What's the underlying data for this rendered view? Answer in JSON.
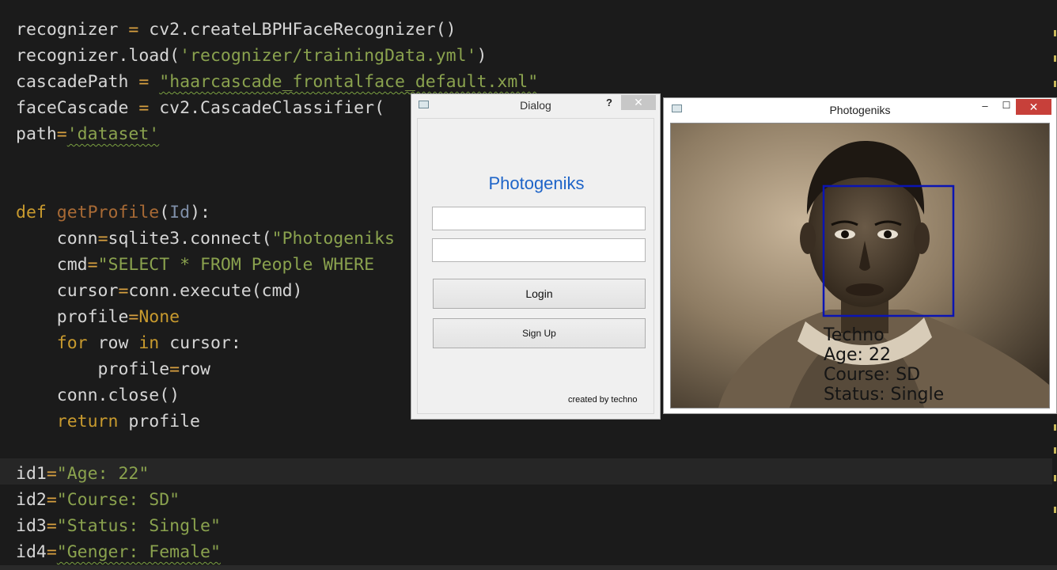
{
  "editor": {
    "lines": {
      "l1_a": "recognizer ",
      "l1_b": "=",
      "l1_c": " cv2.createLBPHFaceRecognizer()",
      "l2_a": "recognizer.load(",
      "l2_b": "'recognizer/trainingData.yml'",
      "l2_c": ")",
      "l3_a": "cascadePath ",
      "l3_b": "=",
      "l3_c": " ",
      "l3_d": "\"haarcascade_frontalface_default.xml\"",
      "l4_a": "faceCascade ",
      "l4_b": "=",
      "l4_c": " cv2.CascadeClassifier(",
      "l5_a": "path",
      "l5_b": "=",
      "l5_c": "'dataset'",
      "l8_a": "def",
      "l8_b": " ",
      "l8_c": "getProfile",
      "l8_d": "(",
      "l8_e": "Id",
      "l8_f": "):",
      "l9_a": "    conn",
      "l9_b": "=",
      "l9_c": "sqlite3.connect(",
      "l9_d": "\"Photogeniks",
      "l10_a": "    cmd",
      "l10_b": "=",
      "l10_c": "\"SELECT * FROM People WHERE",
      "l11_a": "    cursor",
      "l11_b": "=",
      "l11_c": "conn.execute(cmd)",
      "l12_a": "    profile",
      "l12_b": "=",
      "l12_c": "None",
      "l13_a": "    ",
      "l13_b": "for",
      "l13_c": " row ",
      "l13_d": "in",
      "l13_e": " cursor:",
      "l14_a": "        profile",
      "l14_b": "=",
      "l14_c": "row",
      "l15_a": "    conn.close()",
      "l16_a": "    ",
      "l16_b": "return",
      "l16_c": " profile",
      "l18_a": "id1",
      "l18_b": "=",
      "l18_c": "\"Age: 22\"",
      "l19_a": "id2",
      "l19_b": "=",
      "l19_c": "\"Course: SD\"",
      "l20_a": "id3",
      "l20_b": "=",
      "l20_c": "\"Status: Single\"",
      "l21_a": "id4",
      "l21_b": "=",
      "l21_c": "\"Genger: Female\""
    }
  },
  "dialog": {
    "title": "Dialog",
    "help_label": "?",
    "close_label": "✕",
    "heading": "Photogeniks",
    "username_value": "",
    "password_value": "",
    "login_label": "Login",
    "signup_label": "Sign Up",
    "credit": "created by techno"
  },
  "photo_window": {
    "title": "Photogeniks",
    "minimize_label": "–",
    "maximize_label": "☐",
    "close_label": "✕",
    "box_color": "#0a14b4",
    "labels": {
      "name": "Techno",
      "age": "Age: 22",
      "course": "Course: SD",
      "status": "Status: Single"
    }
  },
  "colors": {
    "editor_bg": "#1b1b1b",
    "keyword": "#c89a2e",
    "string": "#8aa24e",
    "dialog_heading": "#1e64c8",
    "close_red": "#c7403a"
  }
}
